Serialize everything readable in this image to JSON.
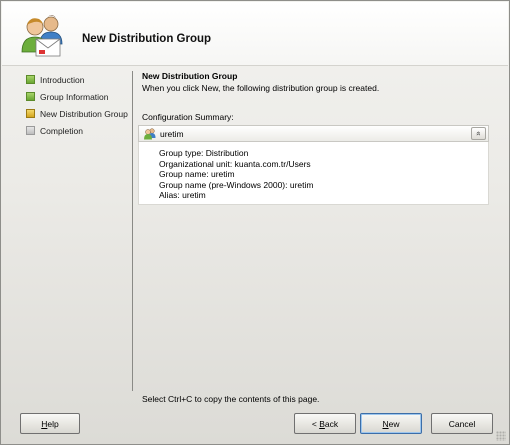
{
  "header": {
    "title": "New Distribution Group",
    "icon": "user-group-icon"
  },
  "steps": [
    {
      "label": "Introduction",
      "state": "done"
    },
    {
      "label": "Group Information",
      "state": "done"
    },
    {
      "label": "New Distribution Group",
      "state": "current"
    },
    {
      "label": "Completion",
      "state": "pending"
    }
  ],
  "content": {
    "title": "New Distribution Group",
    "description": "When you click New, the following distribution group is created.",
    "summary_label": "Configuration Summary:"
  },
  "summary": {
    "name": "uretim",
    "collapse_glyph": "»",
    "lines": [
      "Group type: Distribution",
      "Organizational unit: kuanta.com.tr/Users",
      "Group name: uretim",
      "Group name (pre-Windows 2000): uretim",
      "Alias: uretim"
    ]
  },
  "hint": "Select Ctrl+C to copy the contents of this page.",
  "buttons": {
    "help_accel": "H",
    "help_rest": "elp",
    "back_prefix": "< ",
    "back_accel": "B",
    "back_rest": "ack",
    "new_accel": "N",
    "new_rest": "ew",
    "cancel": "Cancel"
  },
  "colors": {
    "step_done": "#6aa632",
    "step_current": "#d4a51e",
    "step_pending": "#bdbdbd",
    "default_button_border": "#3c6ea8"
  }
}
